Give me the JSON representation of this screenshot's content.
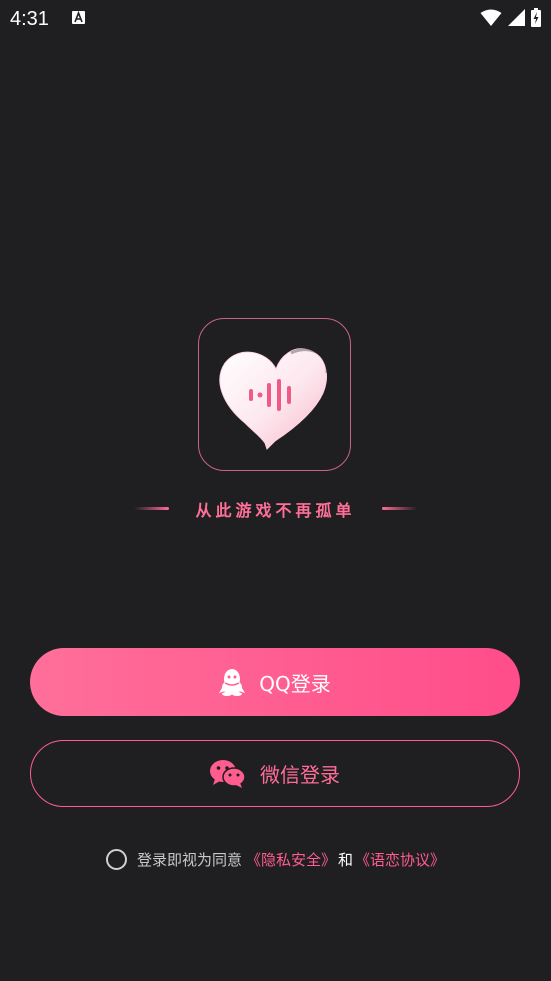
{
  "status_bar": {
    "time": "4:31"
  },
  "slogan": "从此游戏不再孤单",
  "buttons": {
    "qq_label": "QQ登录",
    "wechat_label": "微信登录"
  },
  "agreement": {
    "prefix": "登录即视为同意",
    "privacy_link": "《隐私安全》",
    "and": "和",
    "protocol_link": "《语恋协议》"
  },
  "colors": {
    "background": "#1f1f21",
    "accent": "#ff5c8f"
  }
}
